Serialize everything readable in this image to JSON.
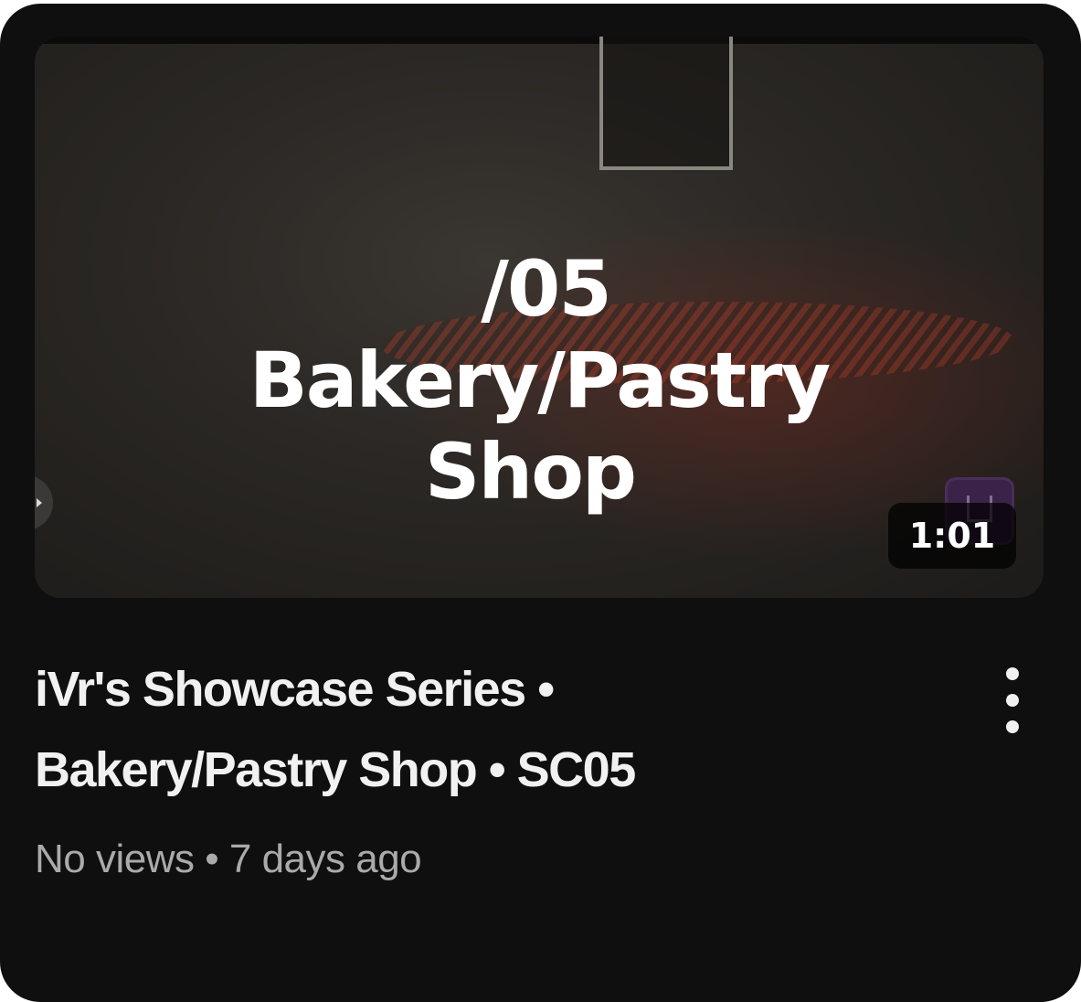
{
  "video": {
    "thumbnail": {
      "overlay_lines": [
        "/05",
        "Bakery/Pastry",
        "Shop"
      ],
      "duration": "1:01"
    },
    "title_lines": [
      "iVr's Showcase Series •",
      "Bakery/Pastry Shop • SC05"
    ],
    "views": "No views",
    "separator": "•",
    "age": "7 days ago"
  },
  "colors": {
    "card_background": "#0f0f0f",
    "title_text": "#f1f1f1",
    "secondary_text": "#aaaaaa"
  },
  "icons": {
    "more": "more-vert-icon"
  }
}
